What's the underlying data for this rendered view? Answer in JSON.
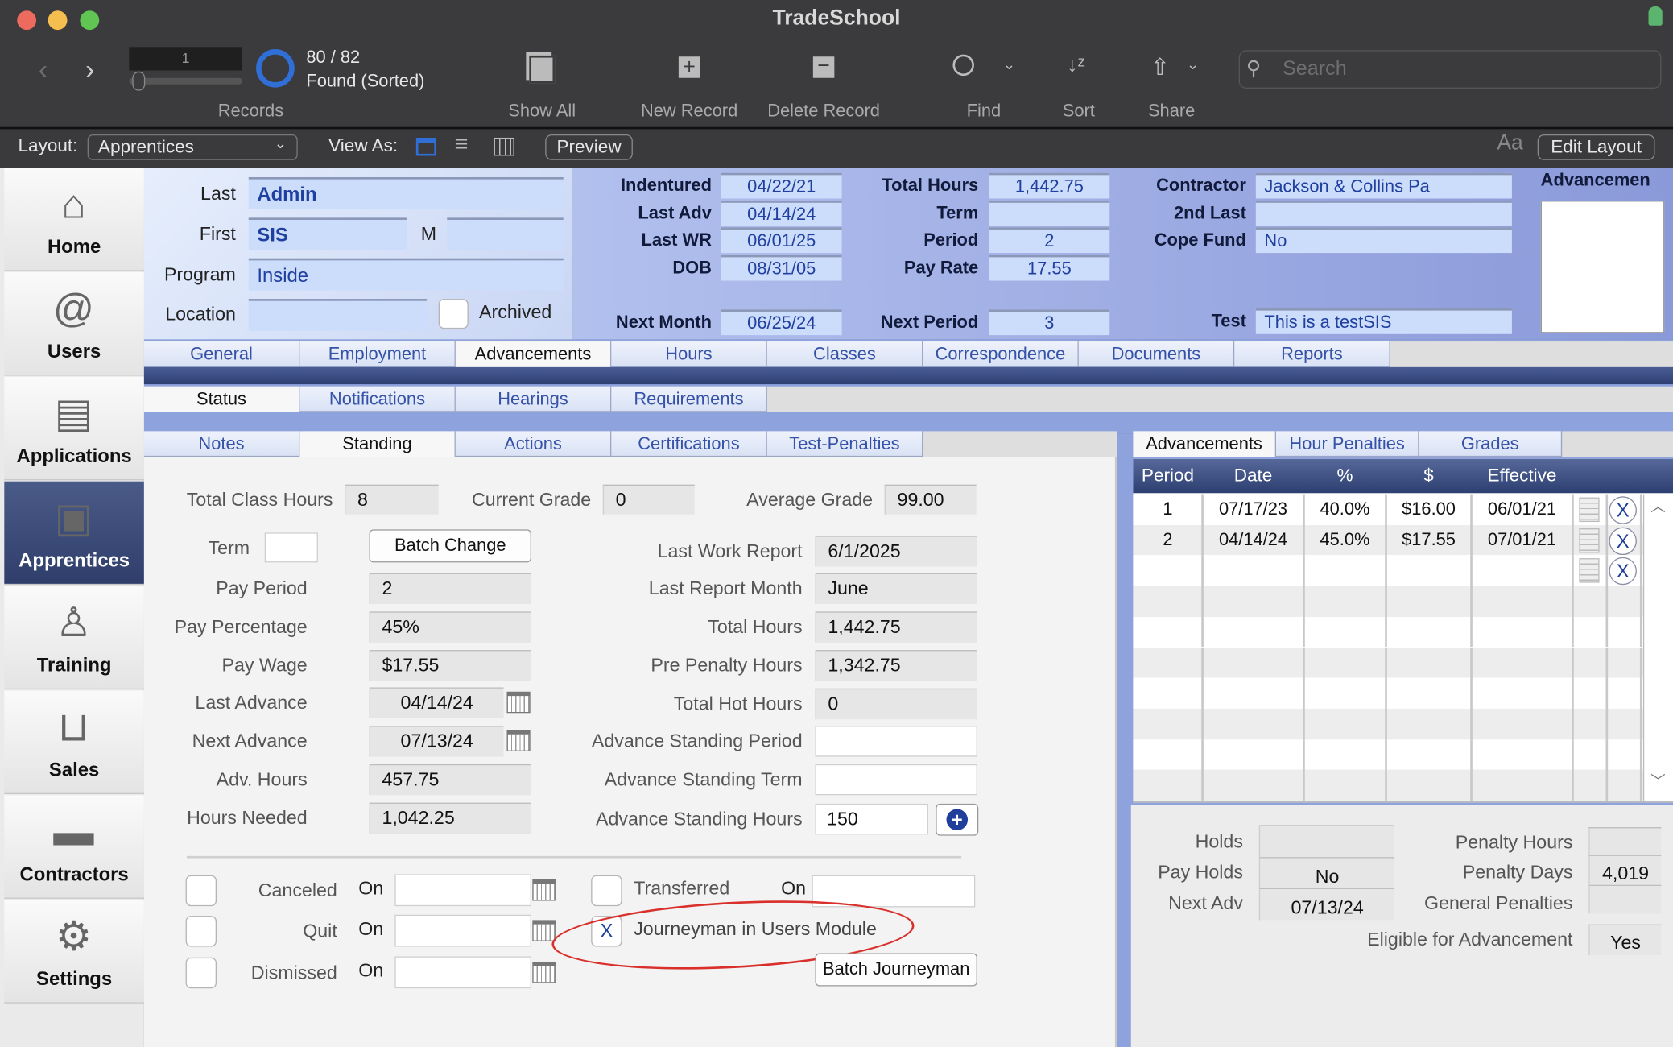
{
  "window": {
    "title": "TradeSchool"
  },
  "toolbar": {
    "record_number": "1",
    "found_count": "80 / 82",
    "found_status": "Found (Sorted)",
    "records_label": "Records",
    "show_all": "Show All",
    "new_record": "New Record",
    "delete_record": "Delete Record",
    "find": "Find",
    "sort": "Sort",
    "share": "Share",
    "search_placeholder": "Search",
    "found_fraction": 0.976
  },
  "layoutbar": {
    "layout_label": "Layout:",
    "layout_value": "Apprentices",
    "view_as_label": "View As:",
    "preview": "Preview",
    "font_size_icon": "Aa",
    "edit_layout": "Edit Layout"
  },
  "sidebar": {
    "selected": "Apprentices",
    "items": [
      {
        "label": "Home",
        "icon": "house-icon",
        "glyph": "⌂"
      },
      {
        "label": "Users",
        "icon": "address-book-icon",
        "glyph": "@"
      },
      {
        "label": "Applications",
        "icon": "clipboard-icon",
        "glyph": "▤"
      },
      {
        "label": "Apprentices",
        "icon": "id-card-icon",
        "glyph": "▣"
      },
      {
        "label": "Training",
        "icon": "podium-icon",
        "glyph": "♙"
      },
      {
        "label": "Sales",
        "icon": "basket-icon",
        "glyph": "⊔"
      },
      {
        "label": "Contractors",
        "icon": "briefcase-icon",
        "glyph": "▬"
      },
      {
        "label": "Settings",
        "icon": "wrench-icon",
        "glyph": "⚙"
      }
    ]
  },
  "header": {
    "last_label": "Last",
    "last": "Admin",
    "first_label": "First",
    "first": "SIS",
    "m_label": "M",
    "middle": "",
    "program_label": "Program",
    "program": "Inside",
    "location_label": "Location",
    "location": "",
    "archived_label": "Archived",
    "col1": [
      {
        "label": "Indentured",
        "value": "04/22/21"
      },
      {
        "label": "Last Adv",
        "value": "04/14/24"
      },
      {
        "label": "Last WR",
        "value": "06/01/25"
      },
      {
        "label": "DOB",
        "value": "08/31/05"
      },
      {
        "label": "Next Month",
        "value": "06/25/24"
      }
    ],
    "col2": [
      {
        "label": "Total Hours",
        "value": "1,442.75"
      },
      {
        "label": "Term",
        "value": ""
      },
      {
        "label": "Period",
        "value": "2"
      },
      {
        "label": "Pay Rate",
        "value": "17.55"
      },
      {
        "label": "Next Period",
        "value": "3"
      }
    ],
    "col3": [
      {
        "label": "Contractor",
        "value": "Jackson & Collins Pa"
      },
      {
        "label": "2nd Last",
        "value": ""
      },
      {
        "label": "Cope Fund",
        "value": "No"
      },
      {
        "label": "Test",
        "value": "This is a testSIS"
      }
    ],
    "advancement_label": "Advancemen"
  },
  "tabs": {
    "main": [
      "General",
      "Employment",
      "Advancements",
      "Hours",
      "Classes",
      "Correspondence",
      "Documents",
      "Reports"
    ],
    "main_selected": 2,
    "sub": [
      "Status",
      "Notifications",
      "Hearings",
      "Requirements"
    ],
    "sub_selected": 0,
    "sub2": [
      "Notes",
      "Standing",
      "Actions",
      "Certifications",
      "Test-Penalties"
    ],
    "sub2_selected": 1
  },
  "standing": {
    "top": [
      {
        "label": "Total Class Hours",
        "value": "8"
      },
      {
        "label": "Current Grade",
        "value": "0"
      },
      {
        "label": "Average Grade",
        "value": "99.00"
      }
    ],
    "term_label": "Term",
    "term": "",
    "batch_change": "Batch Change",
    "left": [
      {
        "label": "Pay Period",
        "value": "2"
      },
      {
        "label": "Pay Percentage",
        "value": "45%"
      },
      {
        "label": "Pay Wage",
        "value": "$17.55"
      },
      {
        "label": "Last Advance",
        "value": "04/14/24"
      },
      {
        "label": "Next Advance",
        "value": "07/13/24"
      },
      {
        "label": "Adv. Hours",
        "value": "457.75"
      },
      {
        "label": "Hours Needed",
        "value": "1,042.25"
      }
    ],
    "right": [
      {
        "label": "Last Work Report",
        "value": "6/1/2025"
      },
      {
        "label": "Last Report Month",
        "value": "June"
      },
      {
        "label": "Total Hours",
        "value": "1,442.75"
      },
      {
        "label": "Pre Penalty Hours",
        "value": "1,342.75"
      },
      {
        "label": "Total Hot Hours",
        "value": "0"
      },
      {
        "label": "Advance Standing Period",
        "value": ""
      },
      {
        "label": "Advance Standing Term",
        "value": ""
      },
      {
        "label": "Advance Standing Hours",
        "value": "150"
      }
    ]
  },
  "status": {
    "on_label": "On",
    "items": [
      {
        "label": "Canceled",
        "checked": false,
        "on": ""
      },
      {
        "label": "Quit",
        "checked": false,
        "on": ""
      },
      {
        "label": "Dismissed",
        "checked": false,
        "on": ""
      }
    ],
    "transferred": {
      "label": "Transferred",
      "checked": false,
      "on": ""
    },
    "journeyman": {
      "label": "Journeyman in Users Module",
      "checked": true,
      "mark": "X"
    },
    "batch_journeyman": "Batch Journeyman"
  },
  "right_panel": {
    "tabs": [
      "Advancements",
      "Hour Penalties",
      "Grades"
    ],
    "tab_selected": 0,
    "columns": [
      "Period",
      "Date",
      "%",
      "$",
      "Effective"
    ],
    "rows": [
      [
        "1",
        "07/17/23",
        "40.0%",
        "$16.00",
        "06/01/21"
      ],
      [
        "2",
        "04/14/24",
        "45.0%",
        "$17.55",
        "07/01/21"
      ]
    ],
    "delete_mark": "X",
    "bottom_left": [
      {
        "label": "Holds",
        "value": ""
      },
      {
        "label": "Pay Holds",
        "value": "No"
      },
      {
        "label": "Next Adv",
        "value": "07/13/24"
      }
    ],
    "bottom_right": [
      {
        "label": "Penalty Hours",
        "value": ""
      },
      {
        "label": "Penalty Days",
        "value": "4,019"
      },
      {
        "label": "General Penalties",
        "value": ""
      },
      {
        "label": "Eligible for Advancement",
        "value": "Yes"
      }
    ]
  },
  "colors": {
    "accent": "#2f6fd6",
    "header_blue": "#8a99d9",
    "selected_sidebar": "#3d4a72",
    "annotation": "#d9302c"
  }
}
